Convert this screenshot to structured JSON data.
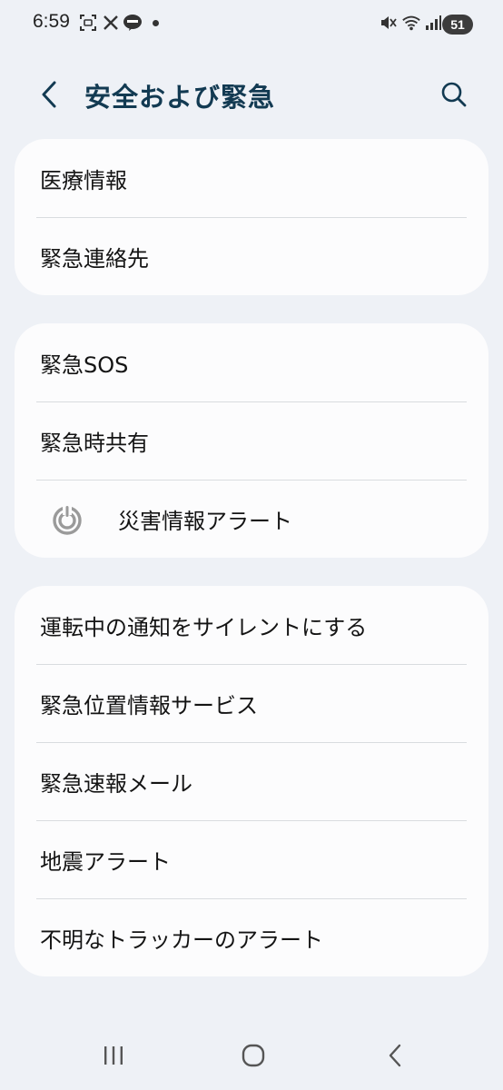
{
  "status_bar": {
    "time": "6:59",
    "battery": "51"
  },
  "header": {
    "title": "安全および緊急"
  },
  "groups": [
    {
      "items": [
        {
          "label": "医療情報"
        },
        {
          "label": "緊急連絡先"
        }
      ]
    },
    {
      "items": [
        {
          "label": "緊急SOS"
        },
        {
          "label": "緊急時共有"
        },
        {
          "label": "災害情報アラート",
          "icon": "alert-signal-icon"
        }
      ]
    },
    {
      "items": [
        {
          "label": "運転中の通知をサイレントにする"
        },
        {
          "label": "緊急位置情報サービス"
        },
        {
          "label": "緊急速報メール"
        },
        {
          "label": "地震アラート"
        },
        {
          "label": "不明なトラッカーのアラート"
        }
      ]
    }
  ],
  "icons": {
    "back": "back-arrow-icon",
    "search": "search-icon",
    "nav_recents": "recent-apps-icon",
    "nav_home": "home-icon",
    "nav_back": "nav-back-icon"
  },
  "colors": {
    "background": "#eef1f6",
    "card": "#fcfcfd",
    "title": "#123a52"
  }
}
